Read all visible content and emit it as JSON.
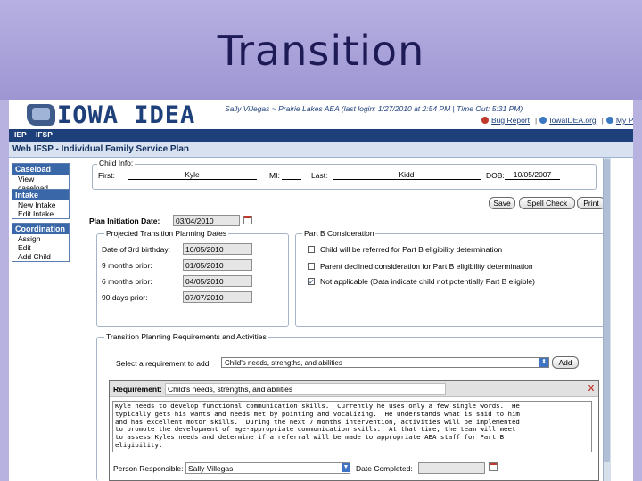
{
  "slide": {
    "title": "Transition"
  },
  "header": {
    "logo_text": "IOWA IDEA",
    "user_line": "Sally Villegas ~ Prairie Lakes AEA   (last login: 1/27/2010 at 2:54 PM  |  Time Out: 5:31 PM)",
    "links": [
      "Bug Report",
      "IowaIDEA.org",
      "My P"
    ]
  },
  "nav": {
    "items": [
      "IEP",
      "IFSP"
    ]
  },
  "page_title": "Web IFSP - Individual Family Service Plan",
  "sidebar": {
    "sections": [
      {
        "head": "Caseload",
        "items": [
          "View caseload"
        ]
      },
      {
        "head": "Intake",
        "items": [
          "New Intake",
          "Edit Intake"
        ]
      },
      {
        "head": "Coordination",
        "items": [
          "Assign",
          "Edit",
          "Add Child"
        ]
      }
    ]
  },
  "child_info": {
    "legend": "Child Info:",
    "first_label": "First:",
    "first": "Kyle",
    "mi_label": "MI:",
    "mi": "",
    "last_label": "Last:",
    "last": "Kidd",
    "dob_label": "DOB:",
    "dob": "10/05/2007"
  },
  "buttons": {
    "save": "Save",
    "spell_check": "Spell Check",
    "print": "Print",
    "add": "Add"
  },
  "plan": {
    "label": "Plan Initiation Date:",
    "value": "03/04/2010"
  },
  "transition_dates": {
    "legend": "Projected Transition Planning Dates",
    "rows": [
      {
        "label": "Date of 3rd birthday:",
        "value": "10/05/2010"
      },
      {
        "label": "9 months prior:",
        "value": "01/05/2010"
      },
      {
        "label": "6 months prior:",
        "value": "04/05/2010"
      },
      {
        "label": "90 days prior:",
        "value": "07/07/2010"
      }
    ]
  },
  "part_b": {
    "legend": "Part B Consideration",
    "options": [
      {
        "label": "Child will be referred for Part B eligibility determination",
        "checked": ""
      },
      {
        "label": "Parent declined consideration for Part B eligibility determination",
        "checked": ""
      },
      {
        "label": "Not applicable (Data indicate child not potentially Part B eligible)",
        "checked": "✓"
      }
    ]
  },
  "requirements": {
    "legend": "Transition Planning Requirements and Activities",
    "select_label": "Select a requirement to add:",
    "select_value": "Child's needs, strengths, and abilities",
    "requirement_label": "Requirement:",
    "requirement_value": "Child's needs, strengths, and abilities",
    "close": "X",
    "text": "Kyle needs to develop functional communication skills.  Currently he uses only a few single words.  He\ntypically gets his wants and needs met by pointing and vocalizing.  He understands what is said to him\nand has excellent motor skills.  During the next 7 months intervention, activities will be implemented\nto promote the development of age-appropriate communication skills.  At that time, the team will meet\nto assess Kyles needs and determine if a referral will be made to appropriate AEA staff for Part B\neligibility.",
    "person_label": "Person Responsible:",
    "person_value": "Sally Villegas",
    "date_completed_label": "Date Completed:",
    "date_completed_value": ""
  }
}
